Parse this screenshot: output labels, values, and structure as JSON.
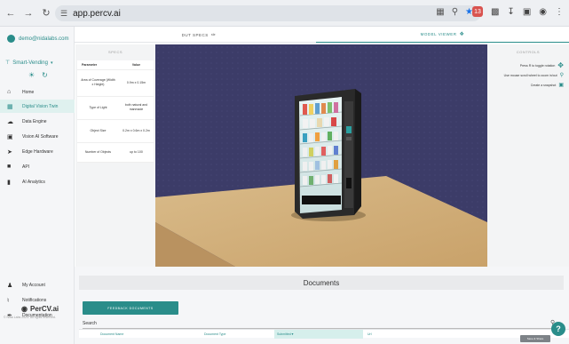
{
  "browser": {
    "url": "app.percv.ai"
  },
  "sidebar": {
    "user_email": "demo@nidalabs.com",
    "project_name": "Smart-Vending",
    "items": [
      {
        "label": "Home",
        "icon": "home-icon"
      },
      {
        "label": "Digital Vision Twin",
        "icon": "digital-twin-icon"
      },
      {
        "label": "Data Engine",
        "icon": "data-engine-icon"
      },
      {
        "label": "Vision AI Software",
        "icon": "software-icon"
      },
      {
        "label": "Edge Hardware",
        "icon": "hardware-icon"
      },
      {
        "label": "API",
        "icon": "api-icon"
      },
      {
        "label": "AI Analytics",
        "icon": "analytics-icon"
      }
    ],
    "active_item": "Digital Vision Twin",
    "bottom_items": [
      {
        "label": "My Account",
        "icon": "account-icon"
      },
      {
        "label": "Notifications",
        "icon": "bell-icon"
      },
      {
        "label": "Documentation",
        "icon": "doc-icon"
      }
    ],
    "logo_text": "PerCV.ai",
    "copyright": "© Nida Labs 2023. All rights reserved."
  },
  "tabs": {
    "dut_specs": "DUT SPECS",
    "model_viewer": "MODEL VIEWER"
  },
  "specs": {
    "title": "SPECS",
    "headers": [
      "Parameter",
      "Value"
    ],
    "rows": [
      {
        "param": "Area of Coverage (Width x Height)",
        "value": "0.9m x 0.15m"
      },
      {
        "param": "Type of Light",
        "value": "both natural and manmade"
      },
      {
        "param": "Object Size",
        "value": "0.2m x 0.6m x 0.2m"
      },
      {
        "param": "Number of Objects",
        "value": "up to 100"
      }
    ]
  },
  "controls": {
    "title": "CONTROLS",
    "line1": "Press R to toggle rotation",
    "line2": "Use mouse scroll wheel to zoom in/out",
    "line3": "Create a snapshot"
  },
  "documents": {
    "title": "Documents",
    "feedback_button": "FEEDBACK DOCUMENTS",
    "search_label": "Search",
    "columns": [
      "Document Name",
      "Document Type",
      "Submitted",
      "Url"
    ]
  },
  "floating": {
    "save_chip": "Save & Share",
    "help": "?"
  }
}
